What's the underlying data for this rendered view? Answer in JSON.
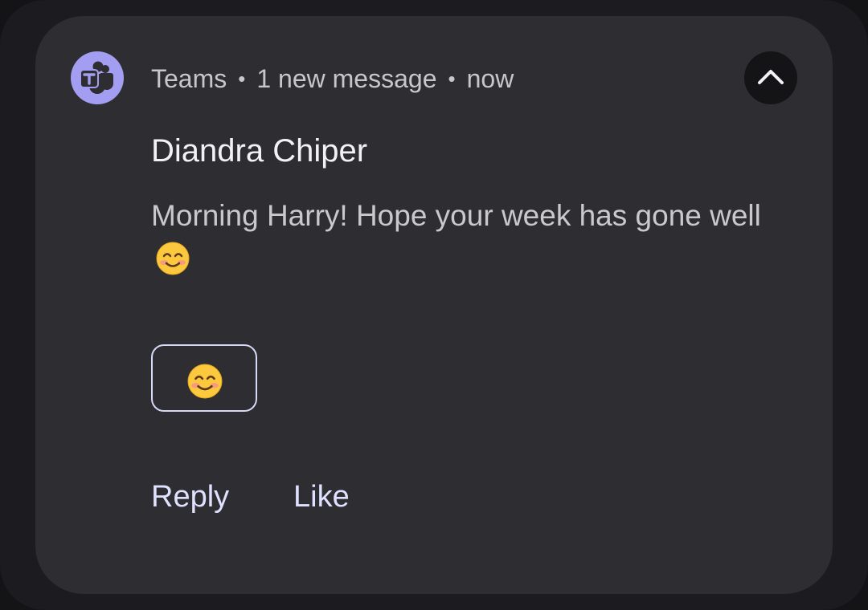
{
  "notification": {
    "app_name": "Teams",
    "separator": "•",
    "summary": "1 new message",
    "time": "now",
    "sender": "Diandra Chiper",
    "message": "Morning Harry! Hope your week has gone well",
    "message_emoji": "smiling-face-icon",
    "app_icon": "teams-icon",
    "expand_icon": "chevron-up-icon"
  },
  "quick_reaction": {
    "emoji": "smiling-face-icon"
  },
  "actions": {
    "reply_label": "Reply",
    "like_label": "Like"
  },
  "colors": {
    "card": "#2e2d32",
    "app_icon_bg": "#a49ef2",
    "action_text": "#dfe1ff",
    "chip_border": "#d6d9f7"
  }
}
